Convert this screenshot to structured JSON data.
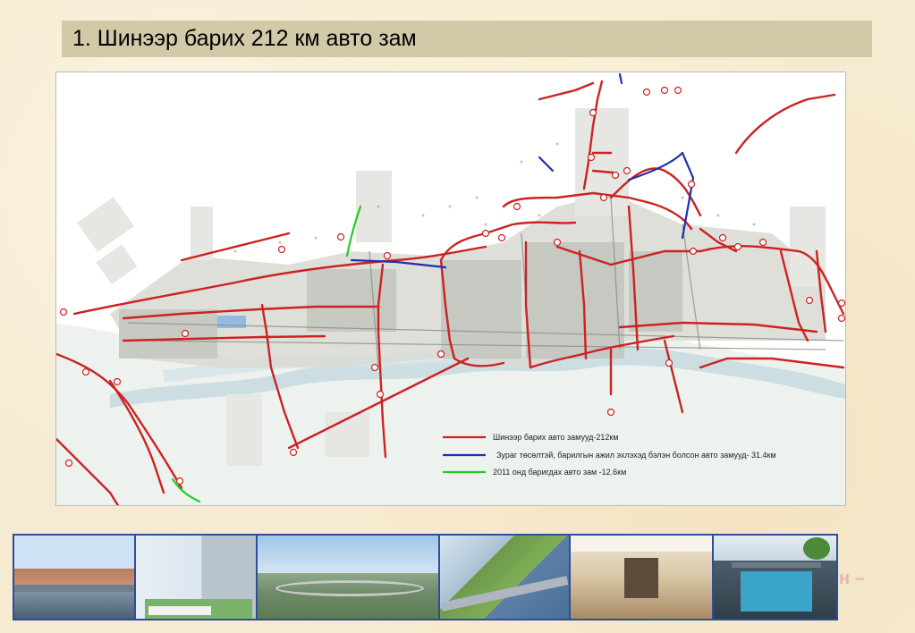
{
  "title": "1. Шинээр барих 212 км авто зам",
  "legend": [
    {
      "label": "Шинээр барих авто замууд-212км",
      "color": "#cc2222"
    },
    {
      "label": "Зураг төсөлтэй, барилгын ажил эхлэхэд бэлэн болсон авто замууд-   31.4км",
      "color": "#1f2fb0"
    },
    {
      "label": "2011 онд баригдах авто зам  -12.6км",
      "color": "#22cc22"
    }
  ],
  "colors": {
    "new_road": "#cc2222",
    "designed_road": "#1f2fb0",
    "road_2011": "#22cc22",
    "river": "#c8dce0",
    "title_bar": "#d2c9a9",
    "strip_border": "#2f4e9a"
  },
  "photos": [
    {
      "name": "photo-overpass-city"
    },
    {
      "name": "photo-building-render"
    },
    {
      "name": "photo-interchange"
    },
    {
      "name": "photo-highway-junction"
    },
    {
      "name": "photo-underground-passage"
    },
    {
      "name": "photo-canal-bridge"
    }
  ],
  "side_text": "н –"
}
